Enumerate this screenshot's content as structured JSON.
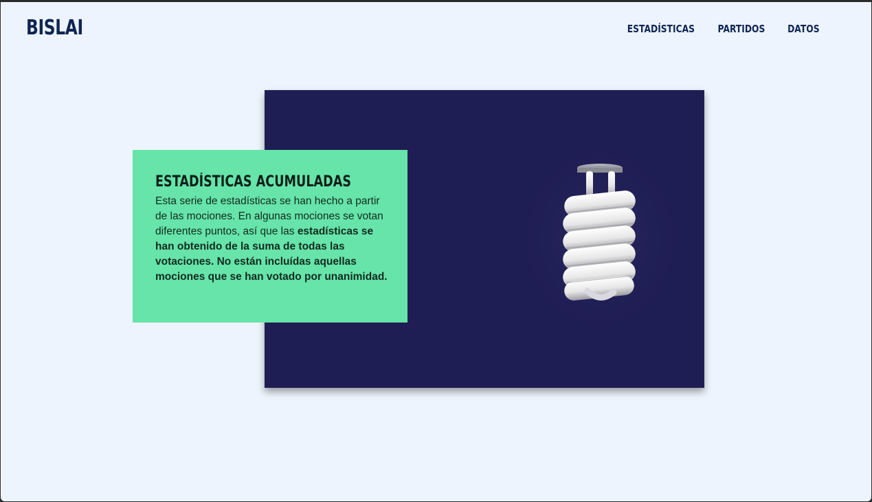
{
  "header": {
    "logo": "BISLAI",
    "nav": [
      {
        "label": "ESTADÍSTICAS"
      },
      {
        "label": "PARTIDOS"
      },
      {
        "label": "DATOS"
      }
    ]
  },
  "card": {
    "title": "ESTADÍSTICAS ACUMULADAS",
    "body_regular": "Esta serie de estadísticas se han hecho a partir de las mociones. En algunas mociones se votan diferentes puntos, así que las ",
    "body_bold": "estadísticas se han obtenido de la suma de todas las votaciones. No están incluídas aquellas mociones que se han votado por unanimidad."
  },
  "hero": {
    "image": "spiral-light-bulb-icon",
    "background_color": "#1f1e54"
  },
  "colors": {
    "page_background": "#edf4fd",
    "card_background": "#66e4a9",
    "brand_navy": "#0f2552"
  }
}
